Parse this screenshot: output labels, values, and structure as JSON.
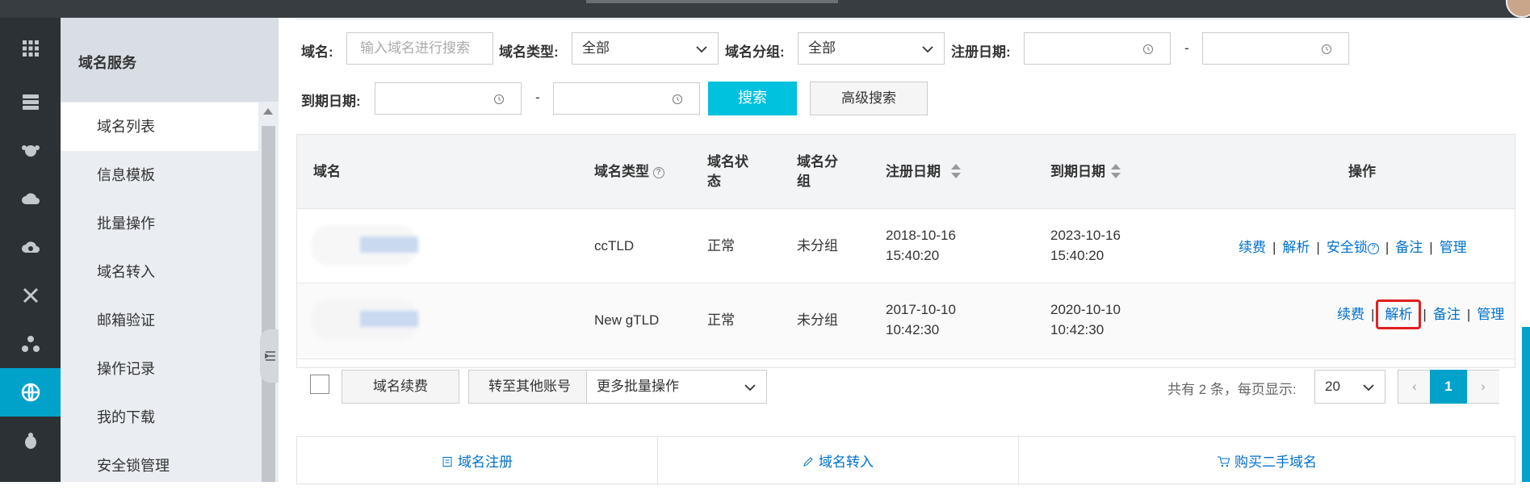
{
  "sidebar": {
    "title": "域名服务",
    "items": [
      {
        "label": "域名列表",
        "active": true
      },
      {
        "label": "信息模板"
      },
      {
        "label": "批量操作"
      },
      {
        "label": "域名转入"
      },
      {
        "label": "邮箱验证"
      },
      {
        "label": "操作记录"
      },
      {
        "label": "我的下载"
      },
      {
        "label": "安全锁管理"
      }
    ]
  },
  "rail_icons": [
    "apps-grid-icon",
    "server-icon",
    "monkey-icon",
    "cloud-icon",
    "cloud-sync-icon",
    "network-icon",
    "cluster-icon",
    "globe-icon",
    "bug-icon"
  ],
  "filters": {
    "domain_label": "域名:",
    "domain_placeholder": "输入域名进行搜索",
    "type_label": "域名类型:",
    "type_value": "全部",
    "group_label": "域名分组:",
    "group_value": "全部",
    "reg_label": "注册日期:",
    "exp_label": "到期日期:",
    "dash": "-",
    "search_button": "搜索",
    "advanced_button": "高级搜索"
  },
  "table": {
    "headers": {
      "domain": "域名",
      "type": "域名类型",
      "status_l1": "域名状",
      "status_l2": "态",
      "group_l1": "域名分",
      "group_l2": "组",
      "reg": "注册日期",
      "exp": "到期日期",
      "ops": "操作"
    },
    "rows": [
      {
        "type": "ccTLD",
        "status": "正常",
        "group": "未分组",
        "reg_date": "2018-10-16",
        "reg_time": "15:40:20",
        "exp_date": "2023-10-16",
        "exp_time": "15:40:20",
        "ops": {
          "renew": "续费",
          "dns": "解析",
          "lock": "安全锁",
          "remark": "备注",
          "manage": "管理"
        }
      },
      {
        "type": "New gTLD",
        "status": "正常",
        "group": "未分组",
        "reg_date": "2017-10-10",
        "reg_time": "10:42:30",
        "exp_date": "2020-10-10",
        "exp_time": "10:42:30",
        "ops": {
          "renew": "续费",
          "dns": "解析",
          "remark": "备注",
          "manage": "管理"
        }
      }
    ],
    "footer": {
      "renew_button": "域名续费",
      "transfer_button": "转至其他账号",
      "bulk_select": "更多批量操作",
      "summary": "共有 2 条，每页显示:",
      "page_size": "20",
      "current_page": "1",
      "prev": "‹",
      "next": "›"
    }
  },
  "bottom_links": {
    "register": "域名注册",
    "transfer_in": "域名转入",
    "buy_second_hand": "购买二手域名"
  },
  "colors": {
    "accent": "#00c1de",
    "link": "#0070cc",
    "highlight": "#e02020",
    "rail": "#2c3135"
  }
}
